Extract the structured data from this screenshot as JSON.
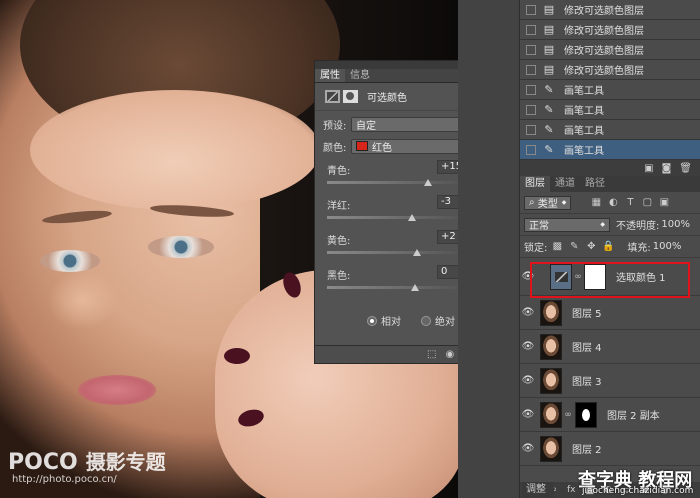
{
  "watermark": {
    "brand": "POCO",
    "subtitle": "摄影专题",
    "url": "http://photo.poco.cn/"
  },
  "properties_panel": {
    "tabs": [
      "属性",
      "信息"
    ],
    "adjustment_title": "可选颜色",
    "preset_label": "预设:",
    "preset_value": "自定",
    "colors_label": "颜色:",
    "colors_value": "红色",
    "colors_swatch": "#d6261b",
    "sliders": [
      {
        "label": "青色:",
        "value": "+15",
        "unit": "%",
        "level": 15
      },
      {
        "label": "洋红:",
        "value": "-3",
        "unit": "%",
        "level": -3
      },
      {
        "label": "黄色:",
        "value": "+2",
        "unit": "%",
        "level": 2
      },
      {
        "label": "黑色:",
        "value": "0",
        "unit": "%",
        "level": 0
      }
    ],
    "method_options": [
      "相对",
      "绝对"
    ],
    "method_selected": "相对"
  },
  "history": {
    "items": [
      {
        "label": "修改可选颜色图层",
        "icon": "doc-icon"
      },
      {
        "label": "修改可选颜色图层",
        "icon": "doc-icon"
      },
      {
        "label": "修改可选颜色图层",
        "icon": "doc-icon"
      },
      {
        "label": "修改可选颜色图层",
        "icon": "doc-icon"
      },
      {
        "label": "画笔工具",
        "icon": "brush-icon"
      },
      {
        "label": "画笔工具",
        "icon": "brush-icon"
      },
      {
        "label": "画笔工具",
        "icon": "brush-icon"
      },
      {
        "label": "画笔工具",
        "icon": "brush-icon",
        "selected": true
      }
    ]
  },
  "layers_panel": {
    "tabs": [
      "图层",
      "通道",
      "路径"
    ],
    "filter_value": "类型",
    "blend_mode": "正常",
    "opacity_label": "不透明度:",
    "opacity_value": "100%",
    "lock_label": "锁定:",
    "fill_label": "填充:",
    "fill_value": "100%",
    "layers": [
      {
        "name": "选取颜色 1",
        "type": "adjustment",
        "active": true
      },
      {
        "name": "图层 5",
        "type": "image"
      },
      {
        "name": "图层 4",
        "type": "image"
      },
      {
        "name": "图层 3",
        "type": "image"
      },
      {
        "name": "图层 2 副本",
        "type": "masked"
      },
      {
        "name": "图层 2",
        "type": "image"
      }
    ],
    "bottom_tab": "调整"
  },
  "site_watermark": {
    "title": "查字典 教程网",
    "url": "jiaocheng.chazidian.com"
  }
}
